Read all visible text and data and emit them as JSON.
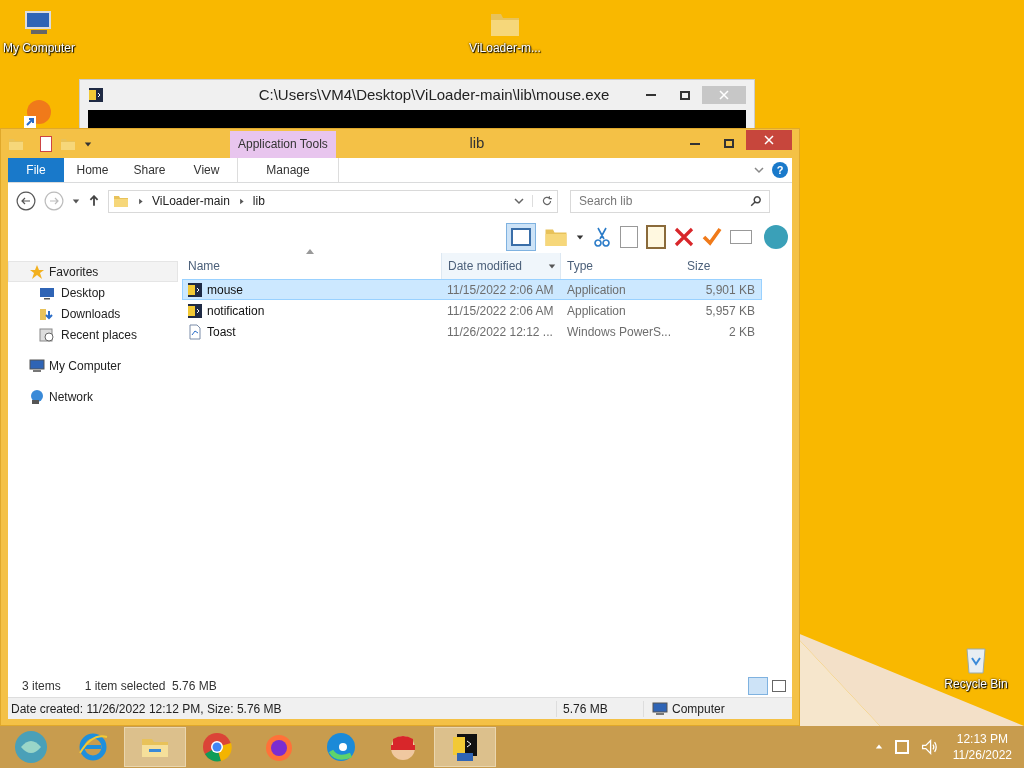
{
  "desktop_icons": [
    {
      "label": "My Computer",
      "kind": "computer"
    },
    {
      "label": "ViLoader-m...",
      "kind": "folder"
    },
    {
      "label": "Recycle Bin",
      "kind": "bin"
    }
  ],
  "console_window": {
    "title": "C:\\Users\\VM4\\Desktop\\ViLoader-main\\lib\\mouse.exe"
  },
  "explorer": {
    "title": "lib",
    "contextual_group": "Application Tools",
    "tabs": [
      {
        "label": "File",
        "kind": "file",
        "selected": false
      },
      {
        "label": "Home",
        "kind": "normal",
        "selected": false
      },
      {
        "label": "Share",
        "kind": "normal",
        "selected": false
      },
      {
        "label": "View",
        "kind": "normal",
        "selected": false
      },
      {
        "label": "Manage",
        "kind": "contextual",
        "selected": false
      }
    ],
    "breadcrumbs": [
      "ViLoader-main",
      "lib"
    ],
    "search": {
      "placeholder": "Search lib"
    },
    "help": "?",
    "columns": [
      {
        "label": "Name",
        "menu": false
      },
      {
        "label": "Date modified",
        "menu": true
      },
      {
        "label": "Type",
        "menu": false
      },
      {
        "label": "Size",
        "menu": false
      }
    ],
    "nav": [
      {
        "label": "Favorites",
        "kind": "star",
        "selected": true,
        "children": [
          {
            "label": "Desktop",
            "kind": "desktop",
            "selected": false
          },
          {
            "label": "Downloads",
            "kind": "downloads",
            "selected": false
          },
          {
            "label": "Recent places",
            "kind": "recent",
            "selected": false
          }
        ]
      },
      {
        "label": "My Computer",
        "kind": "computer",
        "selected": false
      },
      {
        "label": "Network",
        "kind": "network",
        "selected": false
      }
    ],
    "files": [
      {
        "name": "mouse",
        "date": "11/15/2022 2:06 AM",
        "type": "Application",
        "size": "5,901 KB",
        "kind": "app",
        "selected": true
      },
      {
        "name": "notification",
        "date": "11/15/2022 2:06 AM",
        "type": "Application",
        "size": "5,957 KB",
        "kind": "app",
        "selected": false
      },
      {
        "name": "Toast",
        "date": "11/26/2022 12:12 ...",
        "type": "Windows PowerS...",
        "size": "2 KB",
        "kind": "script",
        "selected": false
      }
    ],
    "status": {
      "count": "3 items",
      "selection": "1 item selected  5.76 MB"
    },
    "details": {
      "info": "Date created: 11/26/2022 12:12 PM, Size: 5.76 MB",
      "size": "5.76 MB",
      "location": "Computer"
    }
  },
  "taskbar": {
    "apps": [
      {
        "kind": "start",
        "active": false
      },
      {
        "kind": "ie",
        "active": false
      },
      {
        "kind": "explorer",
        "active": true
      },
      {
        "kind": "chrome",
        "active": false
      },
      {
        "kind": "firefox",
        "active": false
      },
      {
        "kind": "edge",
        "active": false
      },
      {
        "kind": "mask",
        "active": false
      },
      {
        "kind": "console",
        "active": true
      }
    ],
    "time": "12:13 PM",
    "date": "11/26/2022"
  }
}
